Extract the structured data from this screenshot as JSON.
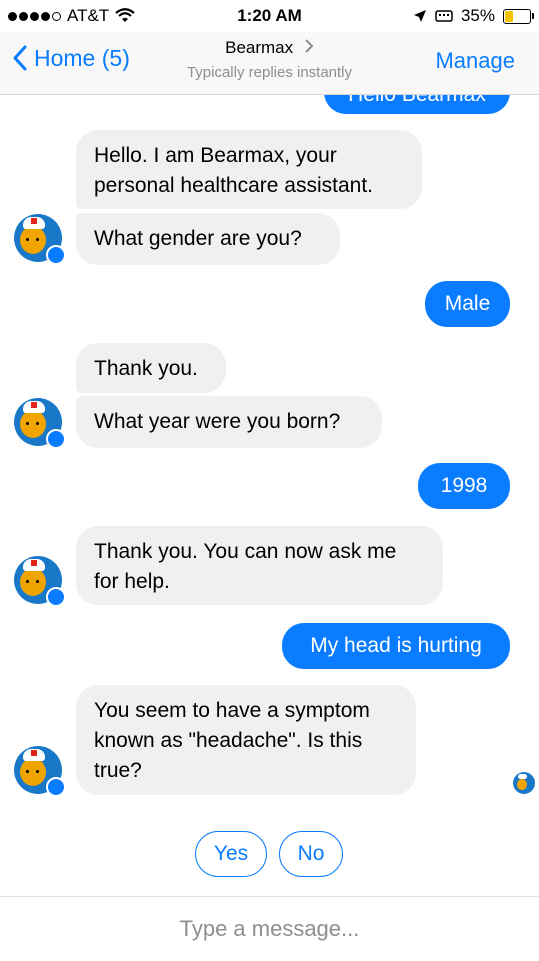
{
  "status_bar": {
    "carrier": "AT&T",
    "time": "1:20 AM",
    "battery": "35%",
    "battery_level": 0.35
  },
  "nav": {
    "back_label": "Home (5)",
    "title": "Bearmax",
    "subtitle": "Typically replies instantly",
    "manage_label": "Manage"
  },
  "messages": [
    {
      "from": "user",
      "text": "Hello Bearmax"
    },
    {
      "from": "bot",
      "text": "Hello. I am Bearmax, your personal healthcare assistant."
    },
    {
      "from": "bot",
      "text": "What gender are you?"
    },
    {
      "from": "user",
      "text": "Male"
    },
    {
      "from": "bot",
      "text": "Thank you."
    },
    {
      "from": "bot",
      "text": "What year were you born?"
    },
    {
      "from": "user",
      "text": "1998"
    },
    {
      "from": "bot",
      "text": "Thank you. You can now ask me for help."
    },
    {
      "from": "user",
      "text": "My head is hurting"
    },
    {
      "from": "bot",
      "text": "You seem to have a symptom known as \"headache\". Is this true?"
    }
  ],
  "quick_replies": [
    "Yes",
    "No"
  ],
  "composer": {
    "placeholder": "Type a message..."
  },
  "colors": {
    "accent": "#0a7cff",
    "bot_bubble": "#f1f0f0",
    "nav_bg": "#f8f8f8"
  }
}
